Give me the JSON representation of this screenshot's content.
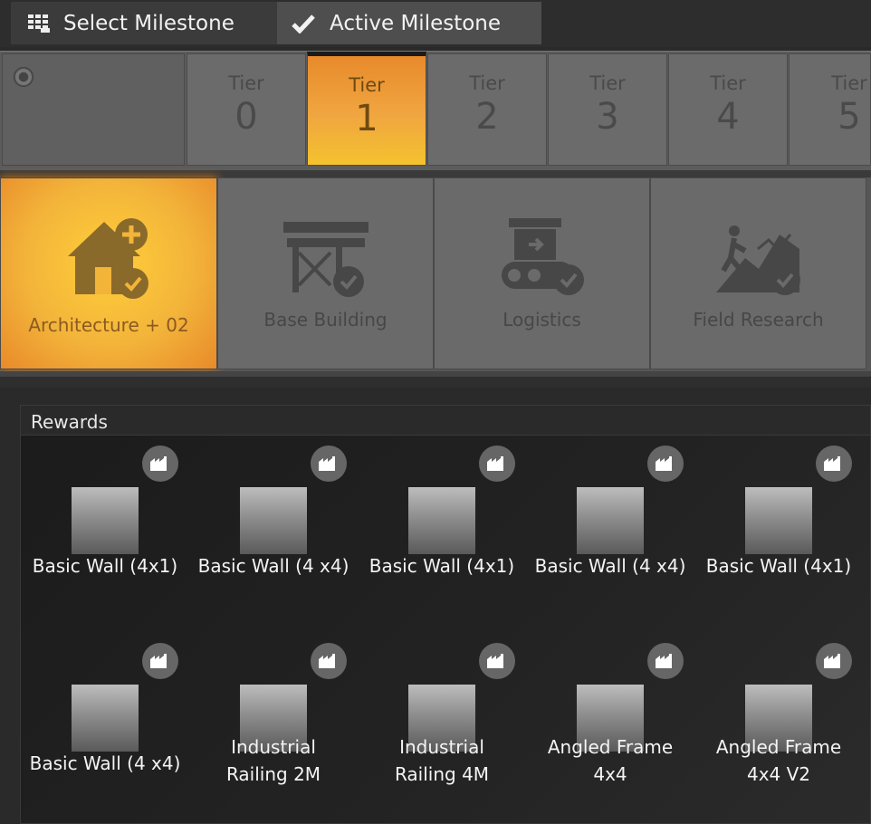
{
  "tabs": [
    {
      "label": "Select Milestone",
      "icon": "grid-icon"
    },
    {
      "label": "Active Milestone",
      "icon": "check-icon"
    }
  ],
  "tiers": [
    {
      "label": "Tier",
      "number": "0"
    },
    {
      "label": "Tier",
      "number": "1",
      "active": true
    },
    {
      "label": "Tier",
      "number": "2"
    },
    {
      "label": "Tier",
      "number": "3"
    },
    {
      "label": "Tier",
      "number": "4"
    },
    {
      "label": "Tier",
      "number": "5"
    }
  ],
  "categories": [
    {
      "label": "Architecture + 02",
      "icon": "house-plus-icon",
      "active": true
    },
    {
      "label": "Base Building",
      "icon": "scaffold-icon"
    },
    {
      "label": "Logistics",
      "icon": "conveyor-icon"
    },
    {
      "label": "Field Research",
      "icon": "mountain-climber-icon"
    }
  ],
  "rewards": {
    "title": "Rewards",
    "items": [
      {
        "name": "Basic Wall (4x1)"
      },
      {
        "name": "Basic Wall (4 x4)"
      },
      {
        "name": "Basic Wall (4x1)"
      },
      {
        "name": "Basic Wall (4 x4)"
      },
      {
        "name": "Basic Wall (4x1)"
      },
      {
        "name": "Basic Wall (4 x4)"
      },
      {
        "name": "Industrial\nRailing 2M"
      },
      {
        "name": "Industrial\nRailing 4M"
      },
      {
        "name": "Angled Frame\n4x4"
      },
      {
        "name": "Angled Frame\n4x4 V2"
      }
    ]
  },
  "colors": {
    "accent_orange": "#f0a640",
    "accent_yellow": "#f4c22e",
    "panel_gray": "#6a6a6a"
  }
}
